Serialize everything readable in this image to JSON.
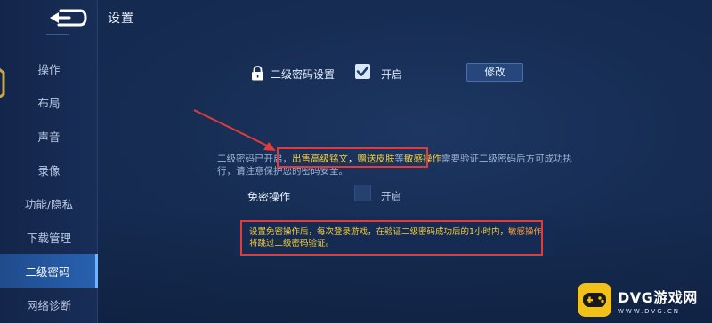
{
  "header": {
    "title": "设置"
  },
  "sidebar": {
    "items": [
      {
        "label": "操作"
      },
      {
        "label": "布局"
      },
      {
        "label": "声音"
      },
      {
        "label": "录像"
      },
      {
        "label": "功能/隐私"
      },
      {
        "label": "下载管理"
      },
      {
        "label": "二级密码",
        "active": true
      },
      {
        "label": "网络诊断"
      }
    ]
  },
  "password": {
    "label": "二级密码设置",
    "checked": true,
    "enable_label": "开启",
    "modify_label": "修改"
  },
  "description": {
    "part1": "二级密码已开启，",
    "hl1": "出售高级铭文",
    "sep": "，",
    "hl2": "赠送皮肤",
    "part2": "等",
    "hl3": "敏感操作",
    "part3": "需要验证二级密码后方可成功执行，请注意保护您的密码安全。"
  },
  "free_pass": {
    "label": "免密操作",
    "checked": false,
    "enable_label": "开启"
  },
  "notice": {
    "text1": "设置免密操作后，每次登录游戏，在验证二级密码成功后的1小时内，",
    "sensitive": "敏感操作",
    "text2": "将跳过二级密码验证。"
  },
  "watermark": {
    "title": "DVG游戏网",
    "subtitle": "WWW.DVG.CN"
  },
  "icons": [
    "back-arrow-icon",
    "lock-icon",
    "check-icon",
    "annotation-arrow-icon",
    "gamepad-logo-icon"
  ],
  "colors": {
    "accent_yellow": "#f5cf3a",
    "annotation_red": "#e23b3b",
    "active_tab": "#2861b0"
  }
}
